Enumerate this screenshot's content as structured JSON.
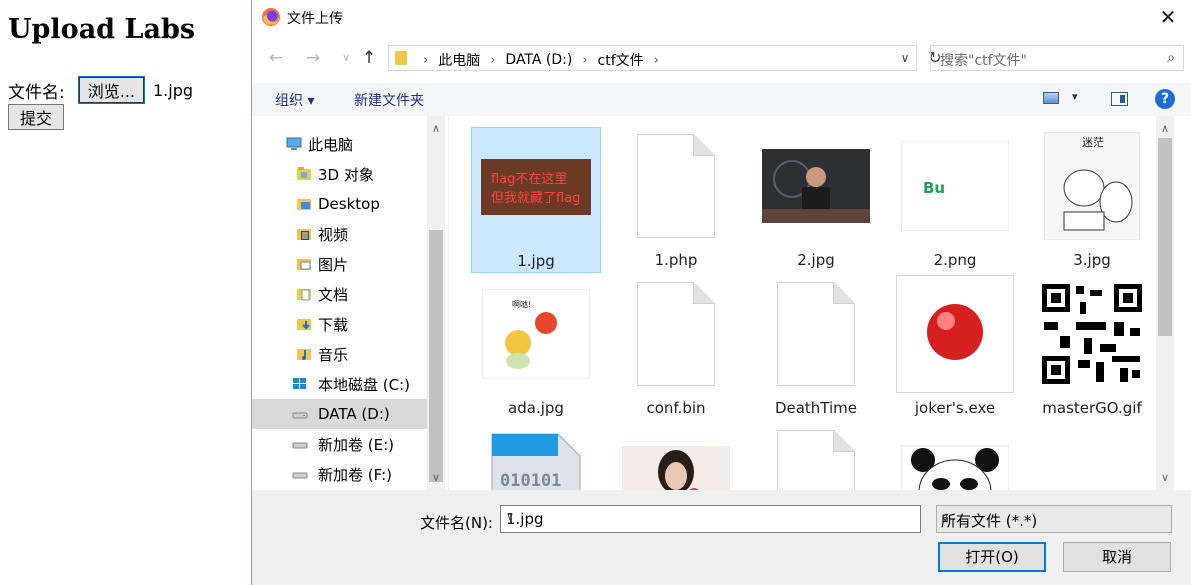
{
  "page": {
    "heading": "Upload Labs",
    "file_label": "文件名:",
    "browse_label": "浏览...",
    "chosen_file": "1.jpg",
    "submit_label": "提交"
  },
  "dialog": {
    "title": "文件上传",
    "close_glyph": "✕",
    "address": {
      "crumbs": [
        "此电脑",
        "DATA (D:)",
        "ctf文件"
      ]
    },
    "search_placeholder": "搜索\"ctf文件\"",
    "toolbar": {
      "organize": "组织 ▾",
      "new_folder": "新建文件夹",
      "help": "?"
    },
    "tree": [
      {
        "label": "此电脑",
        "icon": "computer-icon"
      },
      {
        "label": "3D 对象",
        "icon": "3d-objects-icon"
      },
      {
        "label": "Desktop",
        "icon": "desktop-icon"
      },
      {
        "label": "视频",
        "icon": "videos-icon"
      },
      {
        "label": "图片",
        "icon": "pictures-icon"
      },
      {
        "label": "文档",
        "icon": "documents-icon"
      },
      {
        "label": "下载",
        "icon": "downloads-icon"
      },
      {
        "label": "音乐",
        "icon": "music-icon"
      },
      {
        "label": "本地磁盘 (C:)",
        "icon": "windows-drive-icon"
      },
      {
        "label": "DATA (D:)",
        "icon": "drive-icon"
      },
      {
        "label": "新加卷 (E:)",
        "icon": "drive-icon"
      },
      {
        "label": "新加卷 (F:)",
        "icon": "drive-icon"
      }
    ],
    "files": [
      {
        "name": "1.jpg",
        "thumb_text_1": "flag不在这里",
        "thumb_text_2": "但我就藏了flag"
      },
      {
        "name": "1.php"
      },
      {
        "name": "2.jpg"
      },
      {
        "name": "2.png",
        "thumb_text": "Bu"
      },
      {
        "name": "3.jpg",
        "thumb_text": "迷茫"
      },
      {
        "name": "ada.jpg",
        "thumb_text": "啊哒!"
      },
      {
        "name": "conf.bin"
      },
      {
        "name": "DeathTime"
      },
      {
        "name": "joker's.exe"
      },
      {
        "name": "masterGO.gif"
      },
      {
        "name": "",
        "thumb_text": "010101"
      },
      {
        "name": ""
      },
      {
        "name": ""
      },
      {
        "name": ""
      }
    ],
    "footer": {
      "filename_label": "文件名(N):",
      "filename_value": "1.jpg",
      "filetype": "所有文件 (*.*)",
      "open_label": "打开(O)",
      "cancel_label": "取消"
    }
  },
  "colors": {
    "selection": "#cce8ff",
    "accent": "#0078d7",
    "link_blue": "#1e3287"
  }
}
